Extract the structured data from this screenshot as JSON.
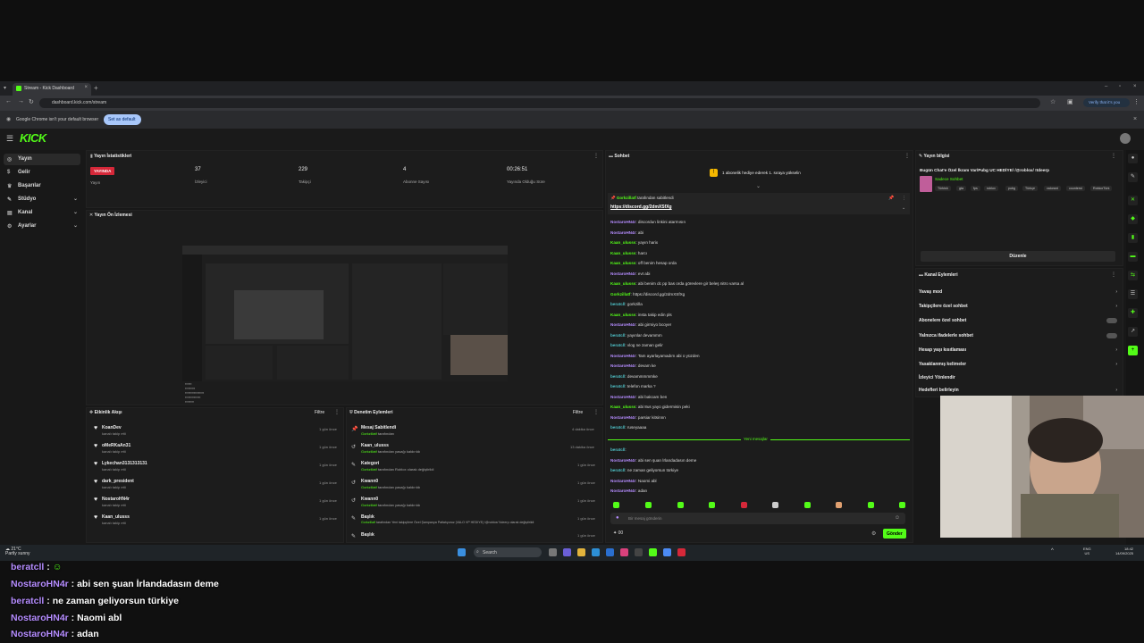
{
  "browser": {
    "tab_title": "Stream - Kick Dashboard",
    "url": "dashboard.kick.com/stream",
    "verify_label": "Verify that it's you",
    "infobar_message": "Google Chrome isn't your default browser",
    "infobar_button": "Set as default"
  },
  "app": {
    "logo": "KICK"
  },
  "sidebar": {
    "items": [
      {
        "label": "Yayın"
      },
      {
        "label": "Gelir"
      },
      {
        "label": "Başarılar"
      },
      {
        "label": "Stüdyo"
      },
      {
        "label": "Kanal"
      },
      {
        "label": "Ayarlar"
      }
    ]
  },
  "stats": {
    "title": "Yayın İstatistikleri",
    "live_badge": "YAYINDA",
    "live_label": "Yayın",
    "viewers": "37",
    "viewers_label": "İzleyici",
    "followers": "229",
    "followers_label": "Takipçi",
    "subs": "4",
    "subs_label": "Abonne Sayısı",
    "duration": "00:26:51",
    "duration_label": "Yayında Olduğu Süre"
  },
  "preview": {
    "title": "Yayın Ön İzlemesi"
  },
  "activity": {
    "title": "Etkinlik Akışı",
    "filter": "Filtre",
    "items": [
      {
        "name": "KoanDev",
        "sub": "kanalı takip etti",
        "time": "1 gün önce"
      },
      {
        "name": "oMeRKaAn31",
        "sub": "kanalı takip etti",
        "time": "1 gün önce"
      },
      {
        "name": "Lykechan3131313131",
        "sub": "kanalı takip etti",
        "time": "1 gün önce"
      },
      {
        "name": "dark_president",
        "sub": "kanalı takip etti",
        "time": "1 gün önce"
      },
      {
        "name": "NostaroHN4r",
        "sub": "kanalı takip etti",
        "time": "1 gün önce"
      },
      {
        "name": "Kaan_ulusss",
        "sub": "kanalı takip etti",
        "time": "1 gün önce"
      }
    ]
  },
  "moderation": {
    "title": "Denetim Eylemleri",
    "filter": "Filtre",
    "items": [
      {
        "name": "Mesaj Sabitlendi",
        "user": "Gorkzillatf",
        "sub": " tarafından",
        "time": "4 dakika önce"
      },
      {
        "name": "Kaan_ulusss",
        "user": "Gorkzillatf",
        "sub": " tarafından yasağı kaldırıldı",
        "time": "13 dakika önce"
      },
      {
        "name": "Kategori",
        "user": "Gorkzillatf",
        "sub": " tarafından Roblox olarak değiştirildi",
        "time": "1 gün önce"
      },
      {
        "name": "Kwann0",
        "user": "Gorkzillatf",
        "sub": " tarafından yasağı kaldırıldı",
        "time": "1 gün önce"
      },
      {
        "name": "Kwann0",
        "user": "Gorkzillatf",
        "sub": " tarafından yasağı kaldırıldı",
        "time": "1 gün önce"
      },
      {
        "name": "Başlık",
        "user": "Gorkzillatf",
        "sub": " tarafından Yeni takipçilere Özel Şampanya Patlatıyoruz |VALO VP HEDIYE| /@roblox/ !tdeerp olarak değiştirildi",
        "time": "1 gün önce"
      },
      {
        "name": "Başlık",
        "user": "",
        "sub": "",
        "time": "1 gün önce"
      }
    ]
  },
  "chat": {
    "title": "Sohbet",
    "banner": "1 abonelik hediye ederek 1. sıraya yükselin",
    "pinned_user": "Gorkzillatf",
    "pinned_by": " tarafından sabitlendi",
    "pinned_link": "https://discord.gg/2dmXSfXg",
    "messages": [
      {
        "user": "NostaroHN4r",
        "color": "p",
        "text": ": discordun linkini atarmısın"
      },
      {
        "user": "NostaroHN4r",
        "color": "p",
        "text": ": abi"
      },
      {
        "user": "Kaan_ulusss",
        "color": "g",
        "text": ": yayın harix"
      },
      {
        "user": "Kaan_ulusss",
        "color": "g",
        "text": ": harcı"
      },
      {
        "user": "Kaan_ulusss",
        "color": "g",
        "text": ": off benim hesap orda"
      },
      {
        "user": "NostaroHN4r",
        "color": "p",
        "text": ": evt abi"
      },
      {
        "user": "Kaan_ulusss",
        "color": "g",
        "text": ": abi benim dc pp bas orda görevlere gir beleş nitro varsa al"
      },
      {
        "user": "Gorkzillatf",
        "color": "g",
        "text": ": https://discord.gg/2dmXSfXg"
      },
      {
        "user": "beratcll",
        "color": "c",
        "text": ": gorkzilla"
      },
      {
        "user": "Kaan_ulusss",
        "color": "g",
        "text": ": insta takip edin pls"
      },
      {
        "user": "NostaroHN4r",
        "color": "p",
        "text": ": abi girmiyo bcoyer"
      },
      {
        "user": "beratcll",
        "color": "c",
        "text": ": yayınlar devammm"
      },
      {
        "user": "beratcll",
        "color": "c",
        "text": ": vlog ne zaman gelir"
      },
      {
        "user": "NostaroHN4r",
        "color": "p",
        "text": ": Tam ayarlayamadım abi o yüzden"
      },
      {
        "user": "NostaroHN4r",
        "color": "p",
        "text": ": devam ke"
      },
      {
        "user": "beratcll",
        "color": "c",
        "text": ": devammmmmke"
      },
      {
        "user": "beratcll",
        "color": "c",
        "text": ": telefon marka ?"
      },
      {
        "user": "NostaroHN4r",
        "color": "p",
        "text": ": abi bakcam ben"
      },
      {
        "user": "Kaan_ulusss",
        "color": "g",
        "text": ": abi 8us yayo gidermisin peki"
      },
      {
        "user": "NostaroHN4r",
        "color": "p",
        "text": ": parsiar kitsinnn"
      },
      {
        "user": "beratcll",
        "color": "c",
        "text": ": ruseyaaaa"
      }
    ],
    "new_messages_label": "Yeni mesajlar",
    "new_messages": [
      {
        "user": "beratcll",
        "color": "c",
        "text": ":"
      },
      {
        "user": "NostaroHN4r",
        "color": "p",
        "text": ": abi sen şuan İrlandadasın deme"
      },
      {
        "user": "beratcll",
        "color": "c",
        "text": ": ne zaman geliyorsun türkiye"
      },
      {
        "user": "NostaroHN4r",
        "color": "p",
        "text": ": Naomi abl"
      },
      {
        "user": "NostaroHN4r",
        "color": "p",
        "text": ": adan"
      }
    ],
    "input_placeholder": "Bir mesaj gönderin",
    "points": "00",
    "send_label": "Gönder"
  },
  "stream_info": {
    "title": "Yayın bilgisi",
    "stream_title": "Bugün Chat'e Özel İkram Var/Pubg UC HEDİYE/ /@roblox/ !tdeerp",
    "category": "Sadece Sohbet",
    "tags": [
      "Türkish",
      "gta",
      "fps",
      "roblox",
      "pubg",
      "Türkçe",
      "valorant",
      "counterst",
      "RobloxTürk"
    ],
    "edit_label": "Düzenle"
  },
  "channel_actions": {
    "title": "Kanal Eylemleri",
    "items": [
      {
        "label": "Yavaş mod",
        "control": "chevron"
      },
      {
        "label": "Takipçilere özel sohbet",
        "control": "chevron"
      },
      {
        "label": "Abonelere özel sohbet",
        "control": "toggle"
      },
      {
        "label": "Yalnızca ifadelerle sohbet",
        "control": "toggle"
      },
      {
        "label": "Hesap yaşı kısıtlaması",
        "control": "chevron"
      },
      {
        "label": "Yasaklanmış kelimeler",
        "control": "chevron"
      },
      {
        "label": "İzleyici Yönlendir",
        "control": "none"
      },
      {
        "label": "Hedefleri belirleyin",
        "control": "chevron"
      }
    ]
  },
  "taskbar": {
    "weather_temp": "21°C",
    "weather_desc": "Partly sunny",
    "search_label": "Search",
    "lang": "ENG",
    "region": "US",
    "time": "18:42",
    "date": "14/09/2025"
  },
  "overlay_chat": [
    {
      "user": "beratcll",
      "text": " : ",
      "emote": "☺"
    },
    {
      "user": "NostaroHN4r",
      "text": " : abi sen şuan İrlandadasın deme",
      "emote": ""
    },
    {
      "user": "beratcll",
      "text": " : ne zaman geliyorsun türkiye",
      "emote": ""
    },
    {
      "user": "NostaroHN4r",
      "text": " : Naomi abl",
      "emote": ""
    },
    {
      "user": "NostaroHN4r",
      "text": " : adan",
      "emote": ""
    }
  ],
  "colors": {
    "brand": "#53fc18",
    "live": "#d62839",
    "username_purple": "#b58cff"
  }
}
